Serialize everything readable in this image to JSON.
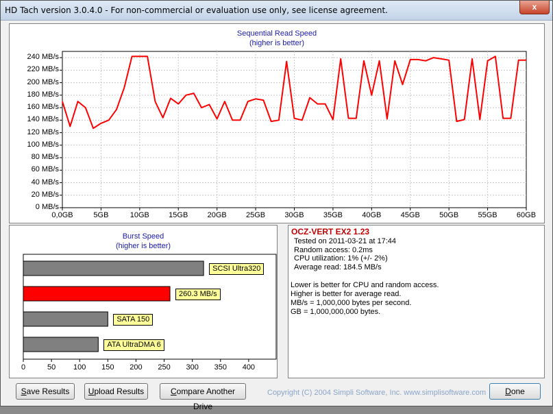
{
  "window": {
    "title": "HD Tach version 3.0.4.0  - For non-commercial or evaluation use only, see license agreement.",
    "close_label": "x"
  },
  "seq_chart": {
    "title": "Sequential Read Speed",
    "subtitle": "(higher is better)"
  },
  "burst_chart": {
    "title": "Burst Speed",
    "subtitle": "(higher is better)"
  },
  "chart_data": [
    {
      "type": "line",
      "title": "Sequential Read Speed",
      "subtitle": "(higher is better)",
      "xlabel": "",
      "ylabel": "",
      "xlim": [
        0,
        60
      ],
      "ylim": [
        0,
        250
      ],
      "x_ticks": [
        "0,0GB",
        "5GB",
        "10GB",
        "15GB",
        "20GB",
        "25GB",
        "30GB",
        "35GB",
        "40GB",
        "45GB",
        "50GB",
        "55GB",
        "60GB"
      ],
      "y_ticks": [
        "0 MB/s",
        "20 MB/s",
        "40 MB/s",
        "60 MB/s",
        "80 MB/s",
        "100 MB/s",
        "120 MB/s",
        "140 MB/s",
        "160 MB/s",
        "180 MB/s",
        "200 MB/s",
        "220 MB/s",
        "240 MB/s"
      ],
      "grid": true,
      "series": [
        {
          "color": "#ff0000",
          "x": [
            0,
            1,
            2,
            3,
            4,
            5,
            6,
            7,
            8,
            9,
            10,
            11,
            12,
            13,
            14,
            15,
            16,
            17,
            18,
            19,
            20,
            21,
            22,
            23,
            24,
            25,
            26,
            27,
            28,
            29,
            30,
            31,
            32,
            33,
            34,
            35,
            36,
            37,
            38,
            39,
            40,
            41,
            42,
            43,
            44,
            45,
            46,
            47,
            48,
            49,
            50,
            51,
            52,
            53,
            54,
            55,
            56,
            57,
            58,
            59,
            60
          ],
          "values": [
            170,
            130,
            170,
            160,
            127,
            135,
            140,
            157,
            192,
            242,
            242,
            242,
            170,
            144,
            175,
            166,
            180,
            183,
            160,
            165,
            142,
            170,
            140,
            140,
            170,
            174,
            172,
            138,
            140,
            234,
            143,
            140,
            176,
            166,
            166,
            141,
            238,
            143,
            143,
            235,
            180,
            235,
            142,
            235,
            197,
            237,
            237,
            235,
            240,
            238,
            236,
            138,
            141,
            238,
            141,
            235,
            242,
            143,
            143,
            236,
            236
          ]
        }
      ]
    },
    {
      "type": "bar",
      "orientation": "horizontal",
      "title": "Burst Speed",
      "subtitle": "(higher is better)",
      "xlim": [
        0,
        450
      ],
      "x_ticks": [
        "0",
        "50",
        "100",
        "150",
        "200",
        "250",
        "300",
        "350",
        "400"
      ],
      "categories": [
        "SCSI Ultra320",
        "260.3 MB/s",
        "SATA 150",
        "ATA UltraDMA 6"
      ],
      "values": [
        320,
        260.3,
        150,
        133
      ],
      "colors": [
        "#808080",
        "#ff0000",
        "#808080",
        "#808080"
      ]
    }
  ],
  "info": {
    "drive_name": "OCZ-VERT EX2 1.23",
    "tested_on": "Tested on 2011-03-21 at 17:44",
    "random_access": "Random access: 0.2ms",
    "cpu_utilization": "CPU utilization: 1% (+/- 2%)",
    "average_read": "Average read: 184.5 MB/s",
    "note1": "Lower is better for CPU and random access.",
    "note2": "Higher is better for average read.",
    "note3": "MB/s = 1,000,000 bytes per second.",
    "note4": "GB = 1,000,000,000 bytes."
  },
  "buttons": {
    "save_first": "S",
    "save_rest": "ave Results",
    "upload_first": "U",
    "upload_rest": "pload Results",
    "compare_first": "C",
    "compare_rest": "ompare Another Drive",
    "done_first": "D",
    "done_rest": "one"
  },
  "copyright": "Copyright (C) 2004 Simpli Software, Inc. www.simplisoftware.com",
  "colors": {
    "series_line": "#ff0000",
    "bar_gray": "#808080",
    "bar_highlight": "#ff0000",
    "label_bg": "#ffff99",
    "title_blue": "#1a1aa8",
    "drive_name": "#c00000"
  }
}
